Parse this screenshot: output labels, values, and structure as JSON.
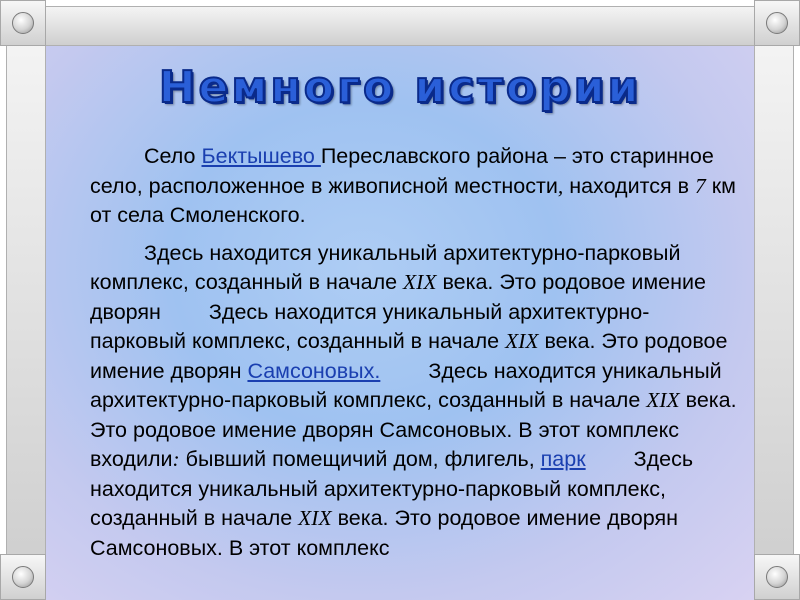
{
  "title": "Немного истории",
  "p1": {
    "t1": "Село ",
    "link_village": "Бектышево ",
    "t2": "Переславского района – это старинное село, расположенное в живописной местности",
    "t3": " находится в ",
    "num": "7",
    "t4": " км от села Смоленского."
  },
  "p2": {
    "a1": "Здесь находится уникальный архитектурно-парковый комплекс, созданный в начале ",
    "century1": "XIX",
    "a2": " века. Это родовое имение дворян",
    "b1": "Здесь находится уникальный архитектурно-парковый комплекс, созданный в начале ",
    "century2": "XIX",
    "b2": " века. Это родовое имение дворян ",
    "link_family": "Самсоновых.",
    "c1": "Здесь находится уникальный архитектурно-парковый комплекс, созданный в начале ",
    "century3": "XIX",
    "c2": " века. Это родовое имение дворян Самсоновых. В этот комплекс входили",
    "c3": " бывший помещичий дом, флигель, ",
    "link_park": "парк",
    "d1": "Здесь находится уникальный архитектурно-парковый комплекс, созданный в начале ",
    "century4": "XIX",
    "d2": " века. Это родовое имение дворян Самсоновых. В этот комплекс"
  }
}
